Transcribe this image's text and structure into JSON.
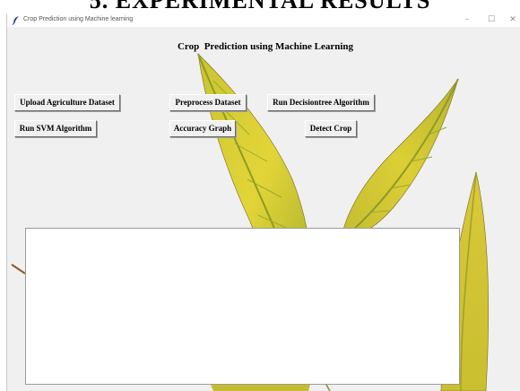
{
  "document": {
    "heading": "5. EXPERIMENTAL RESULTS"
  },
  "window": {
    "title": "Crop Prediction using Machine learning",
    "controls": {
      "minimize": "–",
      "maximize": "☐",
      "close": "✕"
    }
  },
  "app": {
    "title": "Crop  Prediction using Machine Learning",
    "buttons": {
      "upload": "Upload Agriculture Dataset",
      "preprocess": "Preprocess Dataset",
      "decision_tree": "Run Decisiontree Algorithm",
      "svm": "Run SVM Algorithm",
      "accuracy_graph": "Accuracy Graph",
      "detect_crop": "Detect Crop"
    },
    "output_text": ""
  },
  "colors": {
    "window_bg": "#f0f0f0",
    "leaf_yellow": "#d8cc2c",
    "leaf_green": "#98a828",
    "stem_brown": "#8a5a2a"
  },
  "icons": {
    "app_icon": "feather-icon",
    "minimize": "minimize-icon",
    "maximize": "maximize-icon",
    "close": "close-icon"
  }
}
